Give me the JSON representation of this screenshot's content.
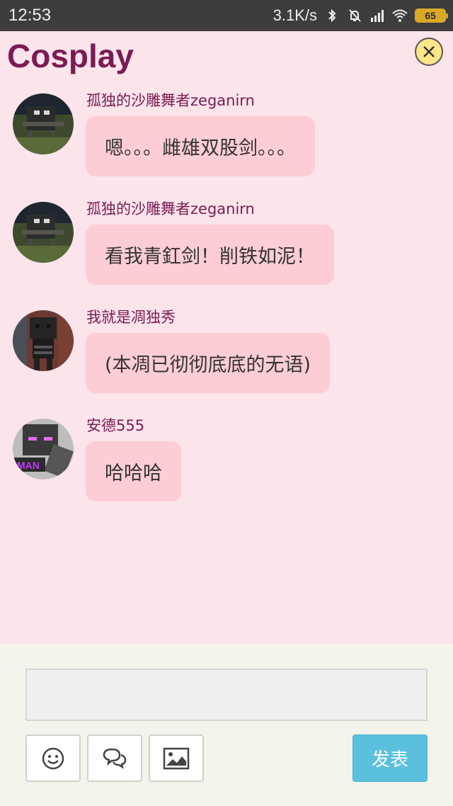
{
  "status_bar": {
    "time": "12:53",
    "network_speed": "3.1K/s",
    "battery_level": "65",
    "icons": [
      "bluetooth-icon",
      "mute-bell-icon",
      "signal-icon",
      "wifi-icon",
      "battery-icon"
    ]
  },
  "header": {
    "title": "Cosplay",
    "close_icon": "close-icon"
  },
  "messages": [
    {
      "username": "孤独的沙雕舞者zeganirn",
      "text": "嗯。。。雌雄双股剑。。。",
      "avatar": "avatar-dark-creature"
    },
    {
      "username": "孤独的沙雕舞者zeganirn",
      "text": "看我青釭剑！削铁如泥！",
      "avatar": "avatar-dark-creature"
    },
    {
      "username": "我就是凋独秀",
      "text": "(本凋已彻彻底底的无语)",
      "avatar": "avatar-wither-skeleton"
    },
    {
      "username": "安德555",
      "text": "哈哈哈",
      "avatar": "avatar-enderman",
      "avatar_text": "MAN"
    }
  ],
  "composer": {
    "input_value": "",
    "input_placeholder": "",
    "send_label": "发表",
    "tools": [
      "emoji-icon",
      "chat-bubbles-icon",
      "image-icon"
    ]
  },
  "colors": {
    "background": "#fbe4ea",
    "title": "#7a1c54",
    "bubble": "#fccdd4",
    "send_button": "#5bc0de",
    "status_bar": "#3d3d3d"
  }
}
